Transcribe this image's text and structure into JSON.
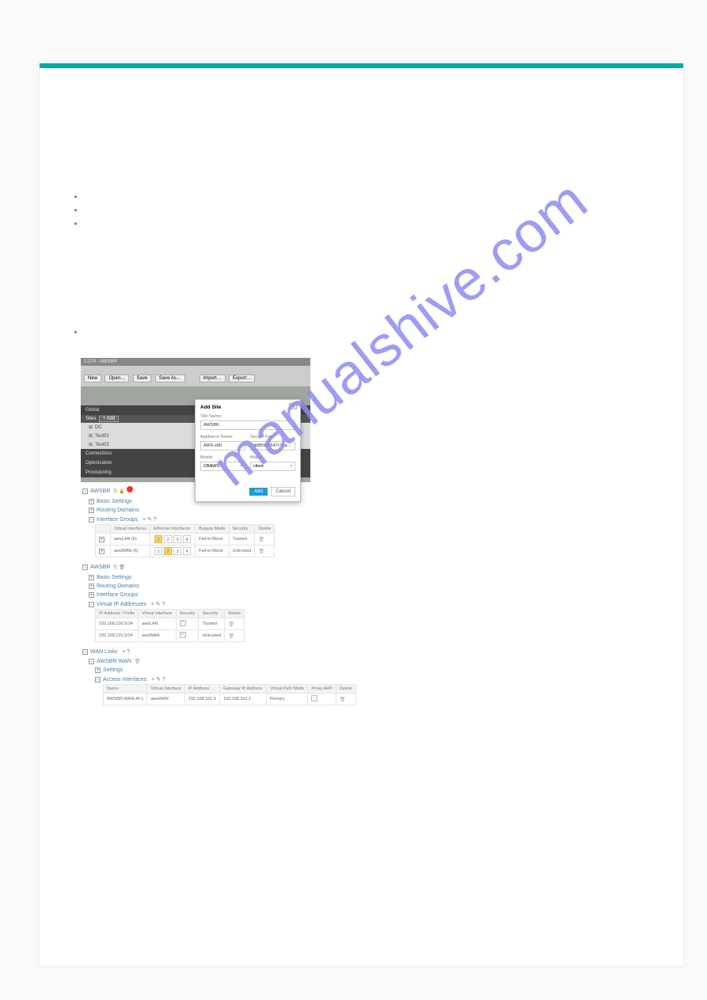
{
  "watermark": "manualshive.com",
  "bullet_items": [
    "",
    "",
    "",
    ""
  ],
  "screenshot1": {
    "breadcrumb": "1:270 - AWSBR",
    "toolbar": {
      "new_btn": "New",
      "open_btn": "Open…",
      "save_btn": "Save",
      "save_as_btn": "Save As…",
      "import_btn": "Import…",
      "export_btn": "Export…"
    },
    "side": {
      "global": "Global",
      "sites": "Sites",
      "add": "+  Add",
      "tree": [
        "DC",
        "Test01",
        "Test02"
      ],
      "connections": "Connections",
      "optimization": "Optimization",
      "provisioning": "Provisioning"
    },
    "modal": {
      "title": "Add Site",
      "close": "X",
      "site_name_label": "Site Name:",
      "site_name_value": "AWSBR",
      "appliance_name_label": "Appliance Name:",
      "appliance_name_value": "AWS-xMI",
      "secure_key_label": "Secure Key:",
      "secure_key_value": "dd9594b547c7aa…",
      "model_label": "Model:",
      "model_value": "CBAWS",
      "mode_label": "Mode:",
      "mode_value": "client",
      "add_btn": "Add",
      "cancel_btn": "Cancel"
    }
  },
  "panel2": {
    "root": "AWSBR",
    "nodes": [
      "Basic Settings",
      "Routing Domains",
      "Interface Groups"
    ],
    "tools": "+  ✎  ?",
    "headers": [
      "Virtual Interfaces",
      "Ethernet Interfaces",
      "Bypass Mode",
      "Security",
      "Delete"
    ],
    "rows": [
      {
        "vi": "awsLAN (6)",
        "eth_sel": "1",
        "bypass": "Fail-to-Block",
        "sec": "Trusted"
      },
      {
        "vi": "awsWAN (6)",
        "eth_sel": "2",
        "bypass": "Fail-to-Block",
        "sec": "Untrusted"
      }
    ]
  },
  "panel3": {
    "root": "AWSBR",
    "nodes": [
      "Basic Settings",
      "Routing Domains",
      "Interface Groups",
      "Virtual IP Addresses"
    ],
    "tools": "+  ✎  ?",
    "headers": [
      "IP Address / Prefix",
      "Virtual Interface",
      "Security",
      "",
      "Security",
      "Delete"
    ],
    "rows": [
      {
        "ip": "192.168.100.5/24",
        "vi": "awsLAN",
        "sec": "Trusted"
      },
      {
        "ip": "192.168.101.5/24",
        "vi": "awsWAN",
        "sec": "Untrusted"
      }
    ]
  },
  "panel4": {
    "root": "WAN Links",
    "tools": "+   ?",
    "site": "AWSBR-WAN",
    "nodes": [
      "Settings",
      "Access Interfaces"
    ],
    "tools2": "+  ✎  ?",
    "headers": [
      "Name",
      "Virtual Interface",
      "IP Address",
      "Gateway IP Address",
      "Virtual Path Mode",
      "Proxy ARP",
      "Delete"
    ],
    "row": {
      "name": "AWSBR-WAN-AI-1",
      "vi": "awsWAN",
      "ip": "192.168.101.5",
      "gw": "192.168.101.1",
      "vpm": "Primary"
    }
  }
}
